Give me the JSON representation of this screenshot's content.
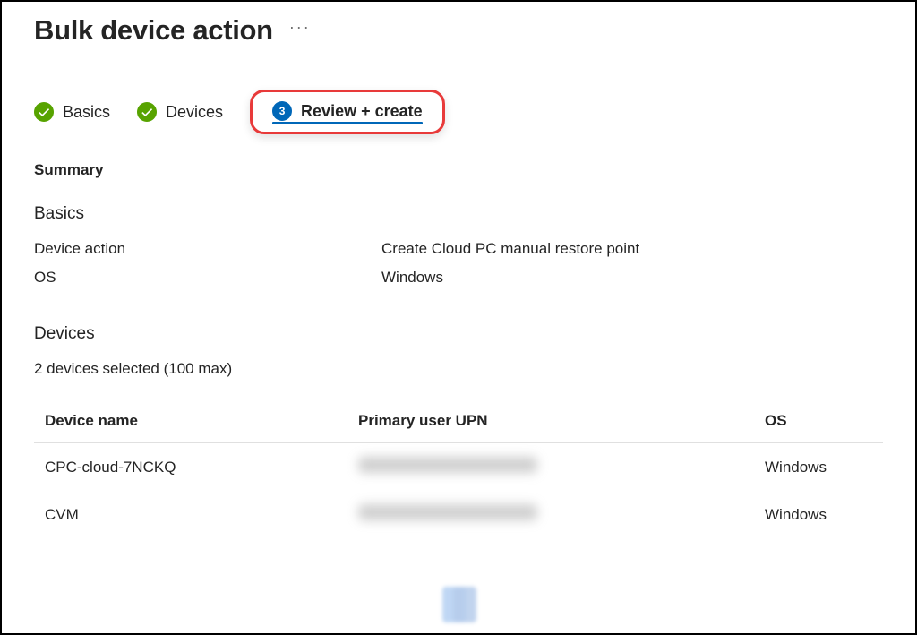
{
  "header": {
    "title": "Bulk device action"
  },
  "wizard": {
    "steps": [
      {
        "label": "Basics",
        "state": "complete"
      },
      {
        "label": "Devices",
        "state": "complete"
      },
      {
        "label": "Review + create",
        "state": "active",
        "number": "3"
      }
    ]
  },
  "summary": {
    "heading": "Summary",
    "basics": {
      "heading": "Basics",
      "rows": [
        {
          "label": "Device action",
          "value": "Create Cloud PC manual restore point"
        },
        {
          "label": "OS",
          "value": "Windows"
        }
      ]
    },
    "devices": {
      "heading": "Devices",
      "selected_text": "2 devices selected (100 max)",
      "columns": {
        "name": "Device name",
        "upn": "Primary user UPN",
        "os": "OS"
      },
      "rows": [
        {
          "name": "CPC-cloud-7NCKQ",
          "upn": "",
          "os": "Windows"
        },
        {
          "name": "CVM",
          "upn": "",
          "os": "Windows"
        }
      ]
    }
  }
}
